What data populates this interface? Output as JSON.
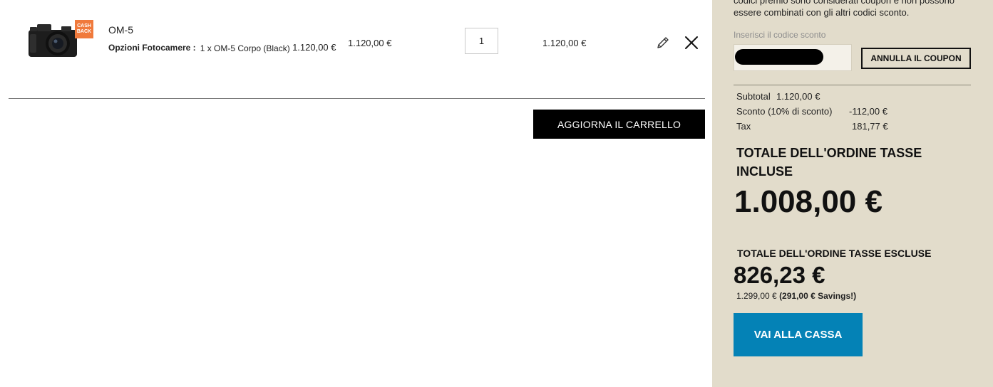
{
  "cart_item": {
    "icon": "camera-product-image",
    "badge": "CASH BACK",
    "badge_color": "#f07a3c",
    "name": "OM-5",
    "options_label": "Opzioni Fotocamere :",
    "options_value": "1 x OM-5 Corpo (Black)",
    "options_price": "1.120,00 €",
    "price": "1.120,00 €",
    "quantity": "1",
    "subtotal": "1.120,00 €",
    "edit_icon": "pencil-icon",
    "remove_icon": "close-icon"
  },
  "cart_actions": {
    "update_label": "AGGIORNA IL CARRELLO"
  },
  "summary": {
    "coupon_notice": "codici premio sono considerati coupon e non possono essere combinati con gli altri codici sconto.",
    "coupon_label": "Inserisci il codice sconto",
    "coupon_value": "",
    "cancel_coupon_label": "ANNULLA IL COUPON",
    "subtotal_label": "Subtotal",
    "subtotal_value": "1.120,00 €",
    "discount_label": "Sconto (10% di sconto)",
    "discount_value": "-112,00 €",
    "tax_label": "Tax",
    "tax_value": "181,77 €",
    "grand_total_label": "TOTALE DELL'ORDINE TASSE INCLUSE",
    "grand_total_value": "1.008,00 €",
    "excl_total_label": "TOTALE DELL'ORDINE TASSE ESCLUSE",
    "excl_total_value": "826,23 €",
    "original_price": "1.299,00 €",
    "savings_text": "(291,00 € Savings!)",
    "checkout_label": "VAI ALLA CASSA"
  },
  "colors": {
    "sidebar_background": "#e2dccb",
    "checkout_button": "#0482b6",
    "update_button": "#000000"
  }
}
